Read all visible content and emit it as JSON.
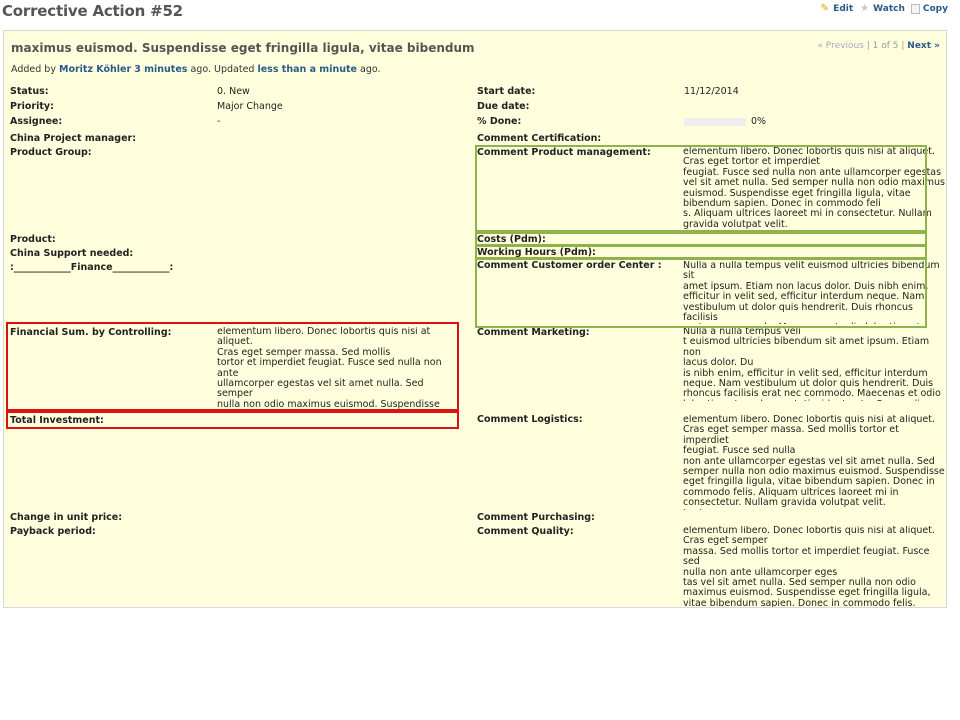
{
  "page_title": "Corrective Action #52",
  "actions": {
    "edit": "Edit",
    "watch": "Watch",
    "copy": "Copy"
  },
  "issue": {
    "subject": "maximus euismod. Suspendisse eget fringilla ligula, vitae bibendum",
    "pager": {
      "previous": "« Previous",
      "sep": "|",
      "position": "1 of 5",
      "sep2": "|",
      "next": "Next »"
    },
    "author": {
      "prefix": "Added by",
      "name": "Moritz Köhler",
      "added_ago": "3 minutes",
      "middle": "ago. Updated",
      "updated_ago": "less than a minute",
      "suffix": "ago."
    }
  },
  "left_fields": {
    "status": {
      "label": "Status:",
      "value": "0. New"
    },
    "priority": {
      "label": "Priority:",
      "value": "Major Change"
    },
    "assignee": {
      "label": "Assignee:",
      "value": "-"
    },
    "china_pm": {
      "label": "China Project manager:"
    },
    "product_group": {
      "label": "Product Group:"
    },
    "product": {
      "label": "Product:"
    },
    "china_support": {
      "label": "China Support needed:"
    },
    "finance": {
      "label": ":____________Finance____________:"
    },
    "financial_sum": {
      "label": "Financial Sum. by Controlling:",
      "value": "elementum libero. Donec lobortis quis nisi at aliquet.\nCras eget semper massa. Sed mollis\ntortor et imperdiet feugiat. Fusce sed nulla non ante\nullamcorper egestas vel sit amet nulla. Sed semper\nnulla non odio maximus euismod. Suspendisse eget\nfringilla ligula, vitae bibendum sapien. Donec in\ncommodo felis. Aliquam ultrices laoreet mi in\nconsectetur. Nullam gravida volutpat velit."
    },
    "total_investment": {
      "label": "Total Investment:"
    },
    "unit_price": {
      "label": "Change in unit price:"
    },
    "payback": {
      "label": "Payback period:"
    }
  },
  "right_fields": {
    "start_date": {
      "label": "Start date:",
      "value": "11/12/2014"
    },
    "due_date": {
      "label": "Due date:"
    },
    "done": {
      "label": "% Done:",
      "value": "0%",
      "percent": 0
    },
    "comment_cert": {
      "label": "Comment Certification:"
    },
    "comment_pm": {
      "label": "Comment Product management:",
      "value": "elementum libero. Donec lobortis quis nisi at aliquet.\nCras eget tortor et imperdiet\nfeugiat. Fusce sed nulla non ante ullamcorper egestas\nvel sit amet nulla. Sed semper nulla non odio maximus\neuismod. Suspendisse eget fringilla ligula, vitae\nbibendum sapien. Donec in commodo feli\ns. Aliquam ultrices laoreet mi in consectetur. Nullam\ngravida volutpat velit."
    },
    "costs": {
      "label": "Costs (Pdm):"
    },
    "working_hours": {
      "label": "Working Hours (Pdm):"
    },
    "comment_coc": {
      "label": "Comment Customer order Center :",
      "value": "Nulla a nulla tempus velit euismod ultricies bibendum sit\namet ipsum. Etiam non lacus dolor. Duis nibh enim,\nefficitur in velit sed, efficitur interdum neque. Nam\nvestibulum ut dolor quis hendrerit. Duis rhoncus facilisis\nerat nec commodo. Maecenas et odio lobortis, rutrum\nlacus ut, tincidunt ante. Suspendisse"
    },
    "comment_marketing": {
      "label": "Comment Marketing:",
      "value": "Nulla a nulla tempus veli\nt euismod ultricies bibendum sit amet ipsum. Etiam non\nlacus dolor. Du\nis nibh enim, efficitur in velit sed, efficitur interdum\nneque. Nam vestibulum ut dolor quis hendrerit. Duis\nrhoncus facilisis erat nec commodo. Maecenas et odio\nlobortis, rutrum lacus ut, tincidunt ante. Suspendisse"
    },
    "comment_logistics": {
      "label": "Comment Logistics:",
      "value": "elementum libero. Donec lobortis quis nisi at aliquet.\nCras eget semper massa. Sed mollis tortor et imperdiet\nfeugiat. Fusce sed nulla\nnon ante ullamcorper egestas vel sit amet nulla. Sed\nsemper nulla non odio maximus euismod. Suspendisse\neget fringilla ligula, vitae bibendum sapien. Donec in\ncommodo felis. Aliquam ultrices laoreet mi in\nconsectetur. Nullam gravida volutpat velit.\ntrzrtz"
    },
    "comment_purchasing": {
      "label": "Comment Purchasing:"
    },
    "comment_quality": {
      "label": "Comment Quality:",
      "value": "elementum libero. Donec lobortis quis nisi at aliquet.\nCras eget semper\nmassa. Sed mollis tortor et imperdiet feugiat. Fusce sed\nnulla non ante ullamcorper eges\ntas vel sit amet nulla. Sed semper nulla non odio\nmaximus euismod. Suspendisse eget fringilla ligula,\nvitae bibendum sapien. Donec in commodo felis.\nAliquam ultrices laoreet mi in consectetur. Nullam"
    }
  },
  "colors": {
    "issue_bg": "#ffffdd",
    "link": "#2a5a8a",
    "highlight_green": "#8db34a",
    "highlight_red": "#dd1111"
  }
}
